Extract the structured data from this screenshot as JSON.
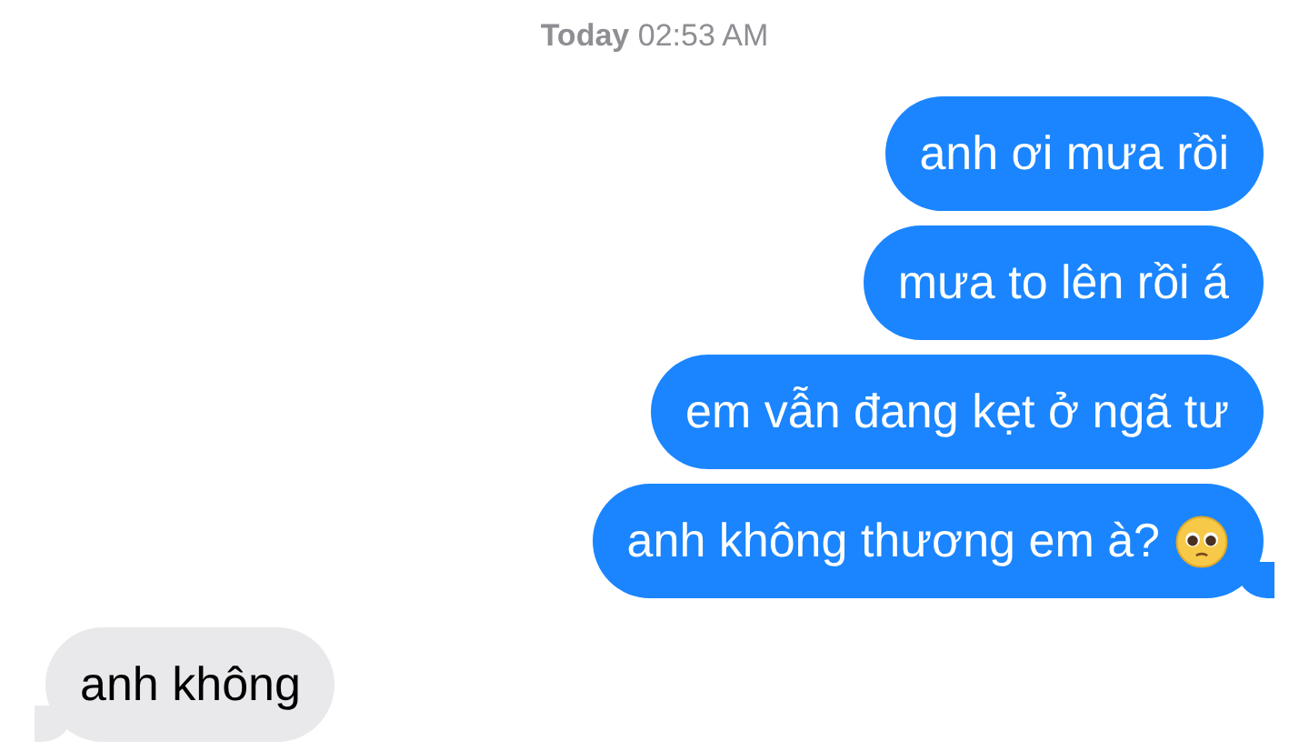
{
  "timestamp": {
    "day": "Today",
    "time": "02:53 AM"
  },
  "messages": [
    {
      "kind": "sent",
      "text": "anh ơi mưa rồi",
      "tail": false,
      "emoji": false
    },
    {
      "kind": "sent",
      "text": "mưa to lên rồi á",
      "tail": false,
      "emoji": false
    },
    {
      "kind": "sent",
      "text": "em vẫn đang kẹt ở ngã tư",
      "tail": false,
      "emoji": false
    },
    {
      "kind": "sent",
      "text": "anh không thương em à?",
      "tail": true,
      "emoji": true
    },
    {
      "kind": "received",
      "text": "anh không",
      "tail": true,
      "emoji": false
    }
  ]
}
